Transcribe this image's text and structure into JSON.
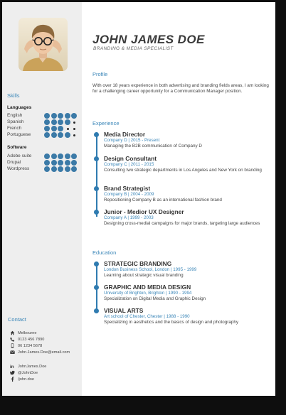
{
  "header": {
    "name": "JOHN JAMES  DOE",
    "role": "BRANDING & MEDIA SPECIALIST"
  },
  "profile": {
    "title": "Profile",
    "text": "With over 18 years experience in both advertising and branding fields areas, I am looking for a challenging career opportunity for a Communication Manager position."
  },
  "skills": {
    "title": "Skills",
    "languages_title": "Languages",
    "languages": [
      {
        "name": "English",
        "level": 5
      },
      {
        "name": "Spanish",
        "level": 4
      },
      {
        "name": "French",
        "level": 3
      },
      {
        "name": "Portuguese",
        "level": 4
      }
    ],
    "software_title": "Software",
    "software": [
      {
        "name": "Adobe suite",
        "level": 5
      },
      {
        "name": "Drupal",
        "level": 5
      },
      {
        "name": "Wordpress",
        "level": 5
      }
    ]
  },
  "contact": {
    "title": "Contact",
    "items": [
      {
        "icon": "home-icon",
        "text": "Melbourne"
      },
      {
        "icon": "phone-icon",
        "text": "0123 456 7890"
      },
      {
        "icon": "mobile-icon",
        "text": "06 1234 5678"
      },
      {
        "icon": "email-icon",
        "text": "John.James.Doe@email.com"
      }
    ],
    "social": [
      {
        "icon": "linkedin-icon",
        "text": "JohnJames.Doe"
      },
      {
        "icon": "twitter-icon",
        "text": "@JohnDoe"
      },
      {
        "icon": "facebook-icon",
        "text": "/john.doe"
      }
    ]
  },
  "experience": {
    "title": "Experience",
    "items": [
      {
        "title": "Media Director",
        "meta": "Company D | 2015 - Present",
        "desc": "Managing the B2B communication of Company D"
      },
      {
        "title": "Design Consultant",
        "meta": "Company C | 2011 - 2015",
        "desc": "Consulting two strategic departments in Los Angeles and New York on branding"
      },
      {
        "title": "Brand Strategist",
        "meta": "Company B | 2004 - 2009",
        "desc": "Repositioning Company B as an international fashion brand"
      },
      {
        "title": "Junior - Medior UX Designer",
        "meta": "Company A | 1999 - 2003",
        "desc": "Designing cross-medial campaigns for major brands, targeting large audiences"
      }
    ]
  },
  "education": {
    "title": "Education",
    "items": [
      {
        "title": "STRATEGIC BRANDING",
        "meta": "London Business School, London | 1995 - 1999",
        "desc": "Learning about strategic visual branding"
      },
      {
        "title": "GRAPHIC AND MEDIA DESIGN",
        "meta": "University of Brighton, Brighton | 1990 - 1994",
        "desc": "Specialization on Digital Media and Graphic Design"
      },
      {
        "title": "VISUAL ARTS",
        "meta": "Art school of Chester, Chester | 1988 - 1990",
        "desc": "Specializing in aesthetics and the basics of design and photography"
      }
    ]
  },
  "colors": {
    "accent": "#3a86b8",
    "dot": "#3b7aa7",
    "sidebar": "#eeeeee"
  }
}
